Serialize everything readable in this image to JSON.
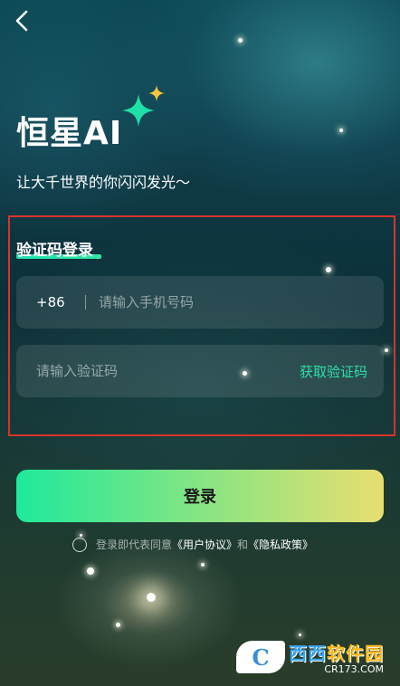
{
  "header": {
    "back_icon": "back-arrow-icon"
  },
  "brand": {
    "title": "恒星AI",
    "slogan": "让大千世界的你闪闪发光～",
    "sparkle_colors": [
      "#1ee0a8",
      "#f3c63f"
    ]
  },
  "login_form": {
    "section_title": "验证码登录",
    "phone": {
      "country_code": "+86",
      "placeholder": "请输入手机号码",
      "value": ""
    },
    "code": {
      "placeholder": "请输入验证码",
      "value": "",
      "get_code_label": "获取验证码"
    },
    "submit_label": "登录"
  },
  "agreement": {
    "checked": false,
    "prefix": "登录即代表同意",
    "user_agreement": "《用户协议》",
    "conjunction": "和",
    "privacy_policy": "《隐私政策》"
  },
  "watermark": {
    "logo_letter": "C",
    "title_part1": "西西",
    "title_part2": "软件园",
    "subtitle": "CR173.COM"
  },
  "colors": {
    "accent_green": "#2fe0a6",
    "highlight_border": "#d8332c",
    "button_gradient": [
      "#1fe99c",
      "#e8de6f"
    ]
  }
}
